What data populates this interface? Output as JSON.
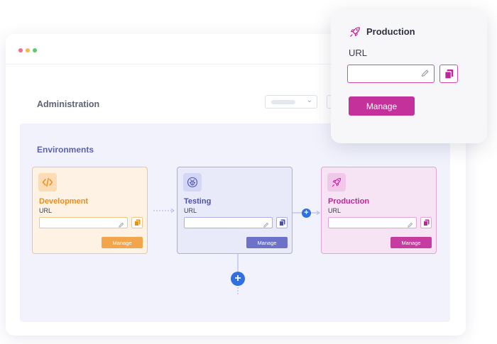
{
  "colors": {
    "dot_red": "#f66a8a",
    "dot_yellow": "#f7b84d",
    "dot_green": "#5bc974",
    "development_accent": "#f2a54a",
    "testing_accent": "#6c72c9",
    "production_accent": "#c73ca0",
    "plus_blue": "#2f6fe0"
  },
  "page": {
    "title": "Administration",
    "section_title": "Environments"
  },
  "environments": [
    {
      "name": "Development",
      "url_label": "URL",
      "url_value": "",
      "manage_label": "Manage",
      "icon": "code-icon"
    },
    {
      "name": "Testing",
      "url_label": "URL",
      "url_value": "",
      "manage_label": "Manage",
      "icon": "bug-icon"
    },
    {
      "name": "Production",
      "url_label": "URL",
      "url_value": "",
      "manage_label": "Manage",
      "icon": "rocket-icon"
    }
  ],
  "popup": {
    "title": "Production",
    "url_label": "URL",
    "url_value": "",
    "manage_label": "Manage",
    "icon": "rocket-icon"
  }
}
